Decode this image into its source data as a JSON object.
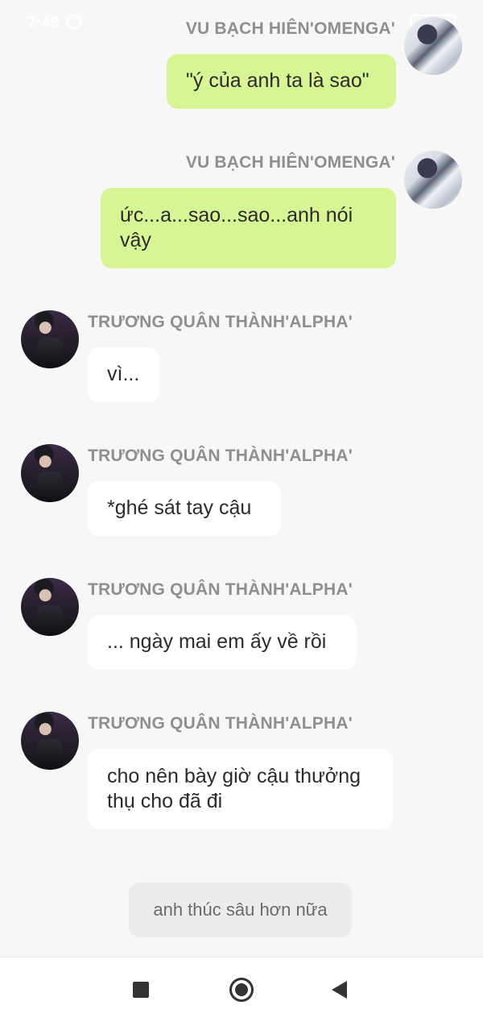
{
  "status_bar": {
    "time": "7:49"
  },
  "messages": [
    {
      "side": "right",
      "sender": "VU BẠCH HIÊN'OMENGA'",
      "text": "\"ý của anh ta là sao\""
    },
    {
      "side": "right",
      "sender": "VU BẠCH HIÊN'OMENGA'",
      "text": "ức...a...sao...sao...anh nói vậy"
    },
    {
      "side": "left",
      "sender": "TRƯƠNG QUÂN THÀNH'ALPHA'",
      "text": "vì..."
    },
    {
      "side": "left",
      "sender": "TRƯƠNG QUÂN THÀNH'ALPHA'",
      "text": "*ghé sát tay cậu"
    },
    {
      "side": "left",
      "sender": "TRƯƠNG QUÂN THÀNH'ALPHA'",
      "text": "... ngày mai em ấy về rồi"
    },
    {
      "side": "left",
      "sender": "TRƯƠNG QUÂN THÀNH'ALPHA'",
      "text": "cho nên bày giờ cậu thưởng thụ cho đã đi"
    }
  ],
  "suggestion": {
    "label": "anh thúc sâu hơn nữa"
  },
  "colors": {
    "my_bubble": "#d7f594",
    "their_bubble": "#ffffff",
    "background": "#f7f7f7",
    "name_text": "#8f8f8f"
  },
  "icons": {
    "nav_recents": "square-icon",
    "nav_home": "home-circle-icon",
    "nav_back": "back-triangle-icon"
  }
}
